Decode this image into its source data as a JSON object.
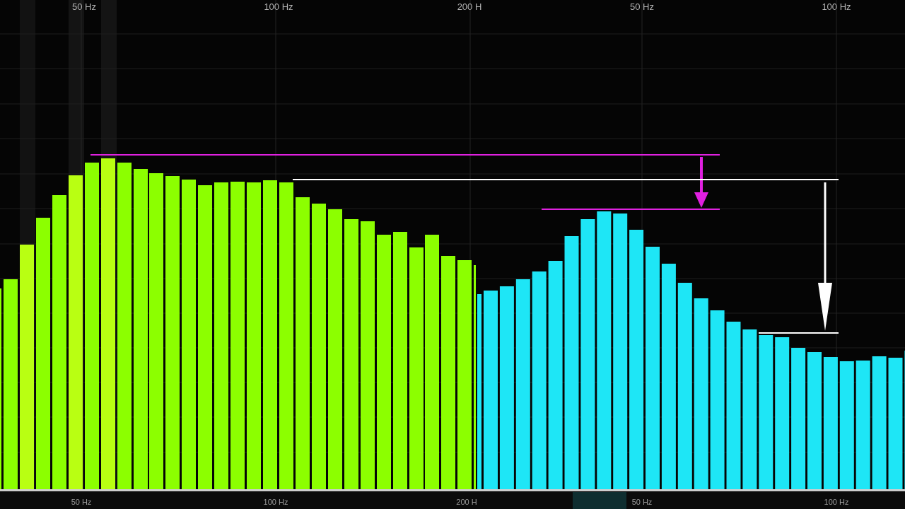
{
  "left_panel": {
    "top_axis": [
      "50 Hz",
      "100 Hz",
      "200 H"
    ],
    "bottom_axis": [
      "50 Hz",
      "100 Hz",
      "200 H"
    ]
  },
  "right_panel": {
    "top_axis": [
      "50 Hz",
      "100 Hz"
    ],
    "bottom_axis": [
      "50 Hz",
      "100 Hz"
    ]
  }
}
